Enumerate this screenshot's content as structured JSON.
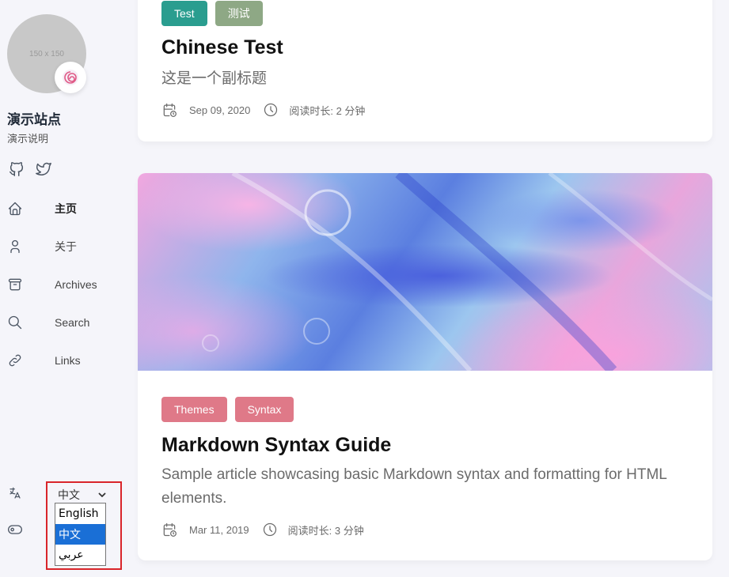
{
  "sidebar": {
    "avatar_placeholder": "150 x 150",
    "avatar_emoji": "🍥",
    "site_name": "演示站点",
    "site_description": "演示说明",
    "social": [
      {
        "icon": "github-icon"
      },
      {
        "icon": "twitter-icon"
      }
    ],
    "menu": [
      {
        "label": "主页",
        "icon": "home-icon",
        "active": true
      },
      {
        "label": "关于",
        "icon": "user-icon",
        "active": false
      },
      {
        "label": "Archives",
        "icon": "archive-icon",
        "active": false
      },
      {
        "label": "Search",
        "icon": "search-icon",
        "active": false
      },
      {
        "label": "Links",
        "icon": "link-icon",
        "active": false
      }
    ],
    "language": {
      "current": "中文",
      "options": [
        "English",
        "中文",
        "عربي"
      ],
      "selected_index": 1
    }
  },
  "posts": [
    {
      "tags": [
        {
          "label": "Test",
          "color": "#2a9d8f"
        },
        {
          "label": "测试",
          "color": "#8ea885"
        }
      ],
      "title": "Chinese Test",
      "subtitle": "这是一个副标题",
      "date": "Sep 09, 2020",
      "reading_time": "阅读时长: 2 分钟"
    },
    {
      "tags": [
        {
          "label": "Themes",
          "color": "#df7988"
        },
        {
          "label": "Syntax",
          "color": "#df7988"
        }
      ],
      "title": "Markdown Syntax Guide",
      "subtitle": "Sample article showcasing basic Markdown syntax and formatting for HTML elements.",
      "date": "Mar 11, 2019",
      "reading_time": "阅读时长: 3 分钟"
    }
  ],
  "colors": {
    "background": "#f5f5fa",
    "card": "#ffffff",
    "selection": "#1a6fd6",
    "highlight_border": "#d9252a"
  }
}
